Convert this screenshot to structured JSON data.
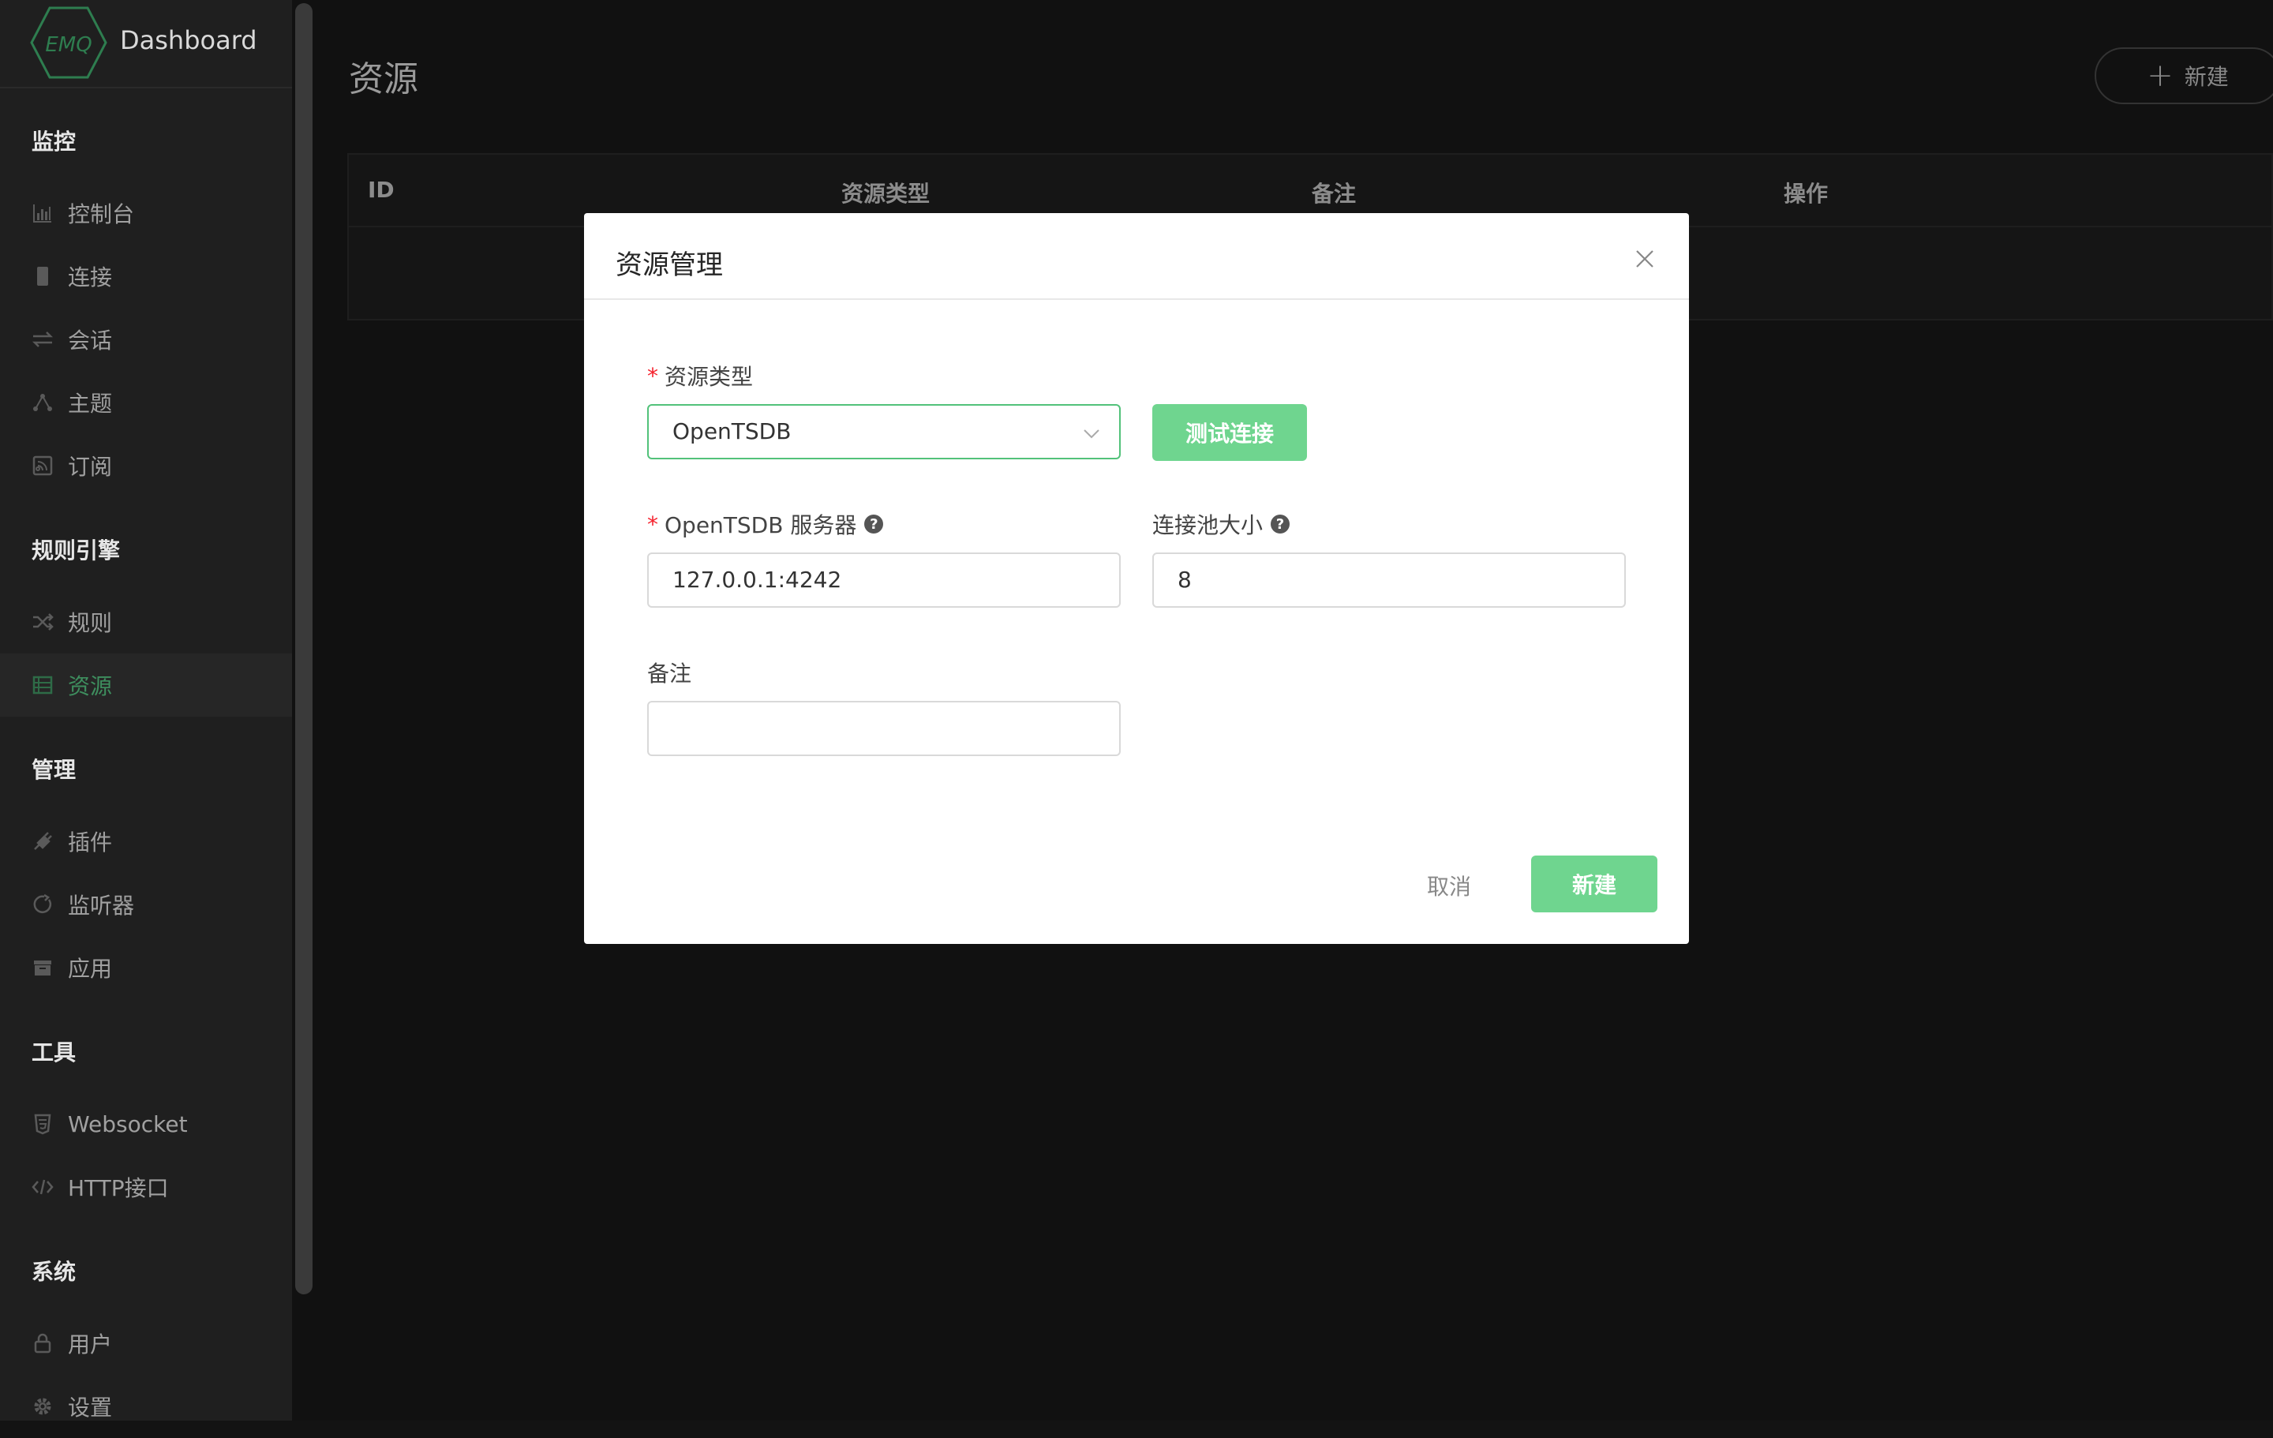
{
  "brand": {
    "logo_text": "EMQ",
    "title": "Dashboard"
  },
  "sidebar": {
    "groups": [
      {
        "title": "监控",
        "items": [
          {
            "label": "控制台",
            "icon": "bar-chart-icon"
          },
          {
            "label": "连接",
            "icon": "phone-icon"
          },
          {
            "label": "会话",
            "icon": "swap-icon"
          },
          {
            "label": "主题",
            "icon": "topic-icon"
          },
          {
            "label": "订阅",
            "icon": "rss-icon"
          }
        ]
      },
      {
        "title": "规则引擎",
        "items": [
          {
            "label": "规则",
            "icon": "shuffle-icon"
          },
          {
            "label": "资源",
            "icon": "database-icon",
            "active": true
          }
        ]
      },
      {
        "title": "管理",
        "items": [
          {
            "label": "插件",
            "icon": "plug-icon"
          },
          {
            "label": "监听器",
            "icon": "listener-icon"
          },
          {
            "label": "应用",
            "icon": "app-icon"
          }
        ]
      },
      {
        "title": "工具",
        "items": [
          {
            "label": "Websocket",
            "icon": "html5-icon"
          },
          {
            "label": "HTTP接口",
            "icon": "code-icon"
          }
        ]
      },
      {
        "title": "系统",
        "items": [
          {
            "label": "用户",
            "icon": "lock-icon"
          },
          {
            "label": "设置",
            "icon": "gear-icon"
          }
        ]
      }
    ]
  },
  "main": {
    "title": "资源",
    "new_button": "新建",
    "table": {
      "columns": [
        "ID",
        "资源类型",
        "备注",
        "操作"
      ]
    }
  },
  "modal": {
    "title": "资源管理",
    "resource_type": {
      "label": "资源类型",
      "value": "OpenTSDB"
    },
    "test_button": "测试连接",
    "server": {
      "label": "OpenTSDB 服务器",
      "value": "127.0.0.1:4242"
    },
    "pool_size": {
      "label": "连接池大小",
      "value": "8"
    },
    "remark": {
      "label": "备注",
      "value": ""
    },
    "cancel_button": "取消",
    "create_button": "新建"
  },
  "colors": {
    "accent_green": "#6fd58f",
    "active_nav": "#3e8e5e",
    "required": "#f5222d"
  }
}
